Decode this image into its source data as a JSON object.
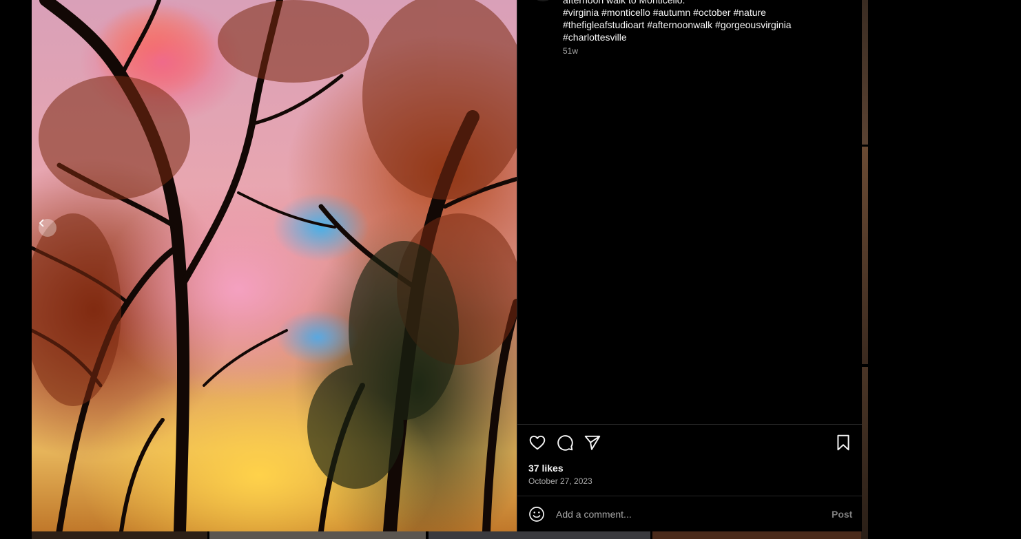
{
  "post": {
    "caption_partial": "afternoon walk to Monticello.",
    "caption_lines": [
      "#virginia #monticello #autumn #october #nature",
      "#thefigleafstudioart #afternoonwalk #gorgeousvirginia",
      "#charlottesville"
    ],
    "timestamp": "51w",
    "likes": "37 likes",
    "date": "October 27, 2023"
  },
  "comment": {
    "placeholder": "Add a comment...",
    "post_label": "Post"
  },
  "icons": {
    "prev": "chevron-left-icon",
    "like": "heart-icon",
    "comment": "comment-icon",
    "share": "send-icon",
    "save": "bookmark-icon",
    "emoji": "smiley-icon"
  }
}
